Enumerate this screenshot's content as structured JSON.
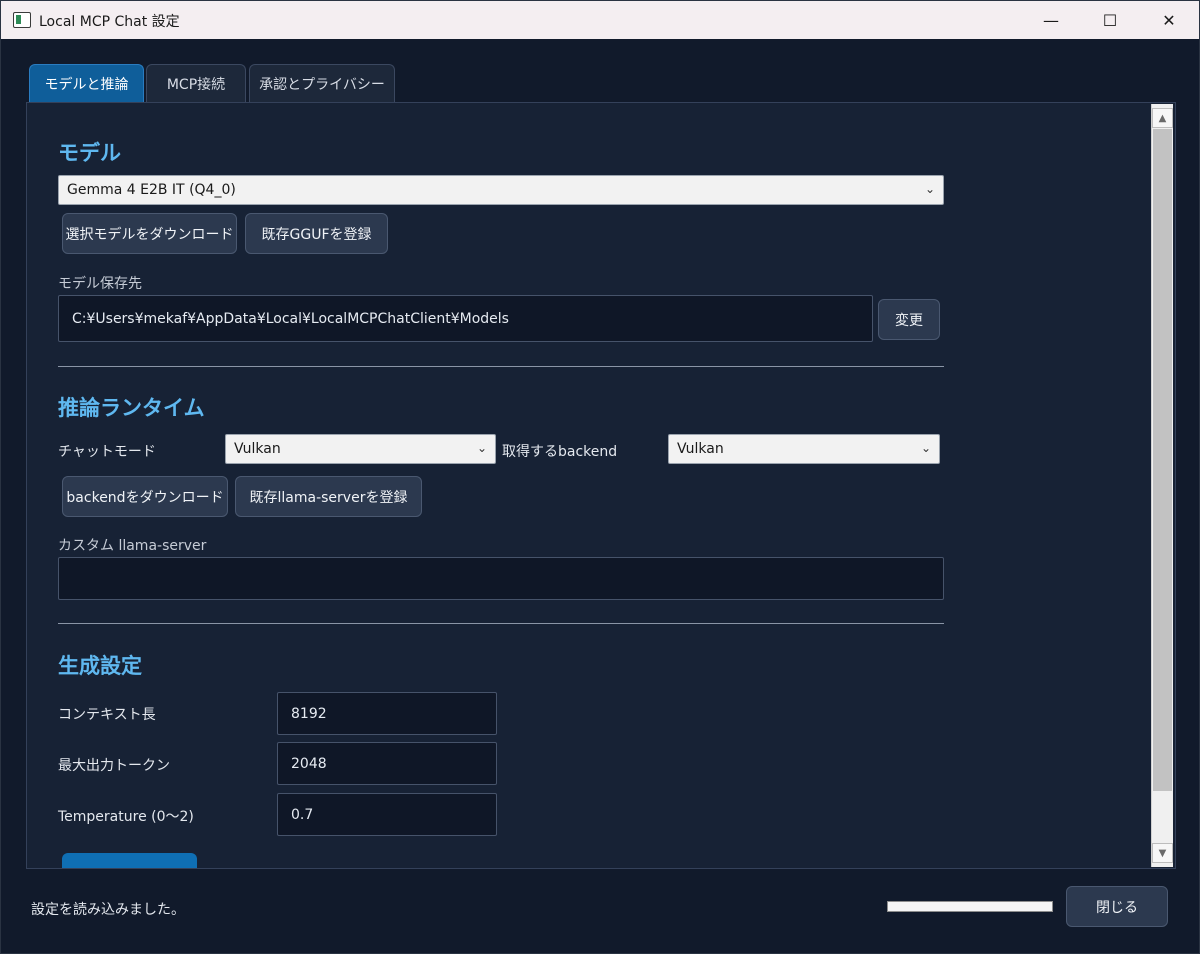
{
  "window": {
    "title": "Local MCP Chat 設定",
    "controls": {
      "minimize": "—",
      "maximize": "☐",
      "close": "✕"
    }
  },
  "tabs": [
    {
      "label": "モデルと推論",
      "active": true
    },
    {
      "label": "MCP接続",
      "active": false
    },
    {
      "label": "承認とプライバシー",
      "active": false
    }
  ],
  "model_section": {
    "title": "モデル",
    "model_select_value": "Gemma 4 E2B IT (Q4_0)",
    "download_button": "選択モデルをダウンロード",
    "register_gguf_button": "既存GGUFを登録",
    "save_path_label": "モデル保存先",
    "save_path_value": "C:¥Users¥mekaf¥AppData¥Local¥LocalMCPChatClient¥Models",
    "change_button": "変更"
  },
  "runtime_section": {
    "title": "推論ランタイム",
    "chat_mode_label": "チャットモード",
    "chat_mode_value": "Vulkan",
    "backend_label": "取得するbackend",
    "backend_value": "Vulkan",
    "download_backend_button": "backendをダウンロード",
    "register_server_button": "既存llama-serverを登録",
    "custom_server_label": "カスタム llama-server",
    "custom_server_value": ""
  },
  "generation_section": {
    "title": "生成設定",
    "context_length_label": "コンテキスト長",
    "context_length_value": "8192",
    "max_tokens_label": "最大出力トークン",
    "max_tokens_value": "2048",
    "temperature_label": "Temperature (0〜2)",
    "temperature_value": "0.7"
  },
  "footer": {
    "status": "設定を読み込みました。",
    "progress_fraction": 0.0,
    "close_button": "閉じる"
  },
  "colors": {
    "background": "#111a2b",
    "panel": "#172235",
    "accent": "#5fb8f0",
    "active_tab": "#0f5e9a",
    "button": "#2c394f"
  },
  "icons": {
    "dropdown": "⌄",
    "scroll_up": "▲",
    "scroll_down": "▼"
  }
}
